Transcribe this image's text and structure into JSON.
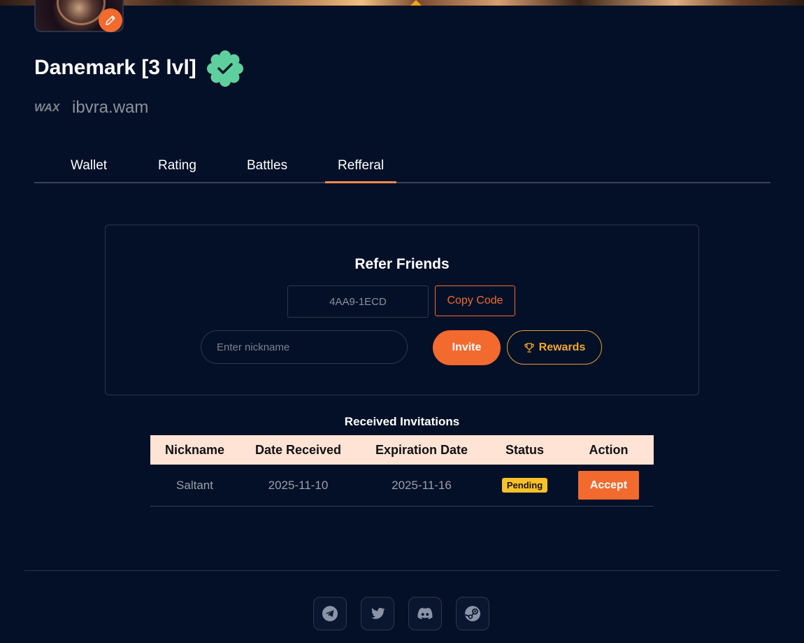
{
  "profile": {
    "name": "Danemark [3 lvl]",
    "wallet": "ibvra.wam",
    "wax_logo": "WAX"
  },
  "tabs": [
    {
      "label": "Wallet"
    },
    {
      "label": "Rating"
    },
    {
      "label": "Battles"
    },
    {
      "label": "Refferal"
    }
  ],
  "refer": {
    "title": "Refer Friends",
    "code": "4AA9-1ECD",
    "copy_label": "Copy Code",
    "nickname_placeholder": "Enter nickname",
    "invite_label": "Invite",
    "rewards_label": "Rewards"
  },
  "invitations": {
    "title": "Received Invitations",
    "columns": [
      "Nickname",
      "Date Received",
      "Expiration Date",
      "Status",
      "Action"
    ],
    "rows": [
      {
        "nickname": "Saltant",
        "date_received": "2025-11-10",
        "expiration_date": "2025-11-16",
        "status": "Pending",
        "action": "Accept"
      }
    ]
  },
  "colors": {
    "background": "#041027",
    "accent": "#f26a2e",
    "verified": "#5fcf9e",
    "pending": "#f6c12a",
    "rewards": "#e0a030"
  },
  "social": [
    "telegram-icon",
    "twitter-icon",
    "discord-icon",
    "steam-icon"
  ]
}
